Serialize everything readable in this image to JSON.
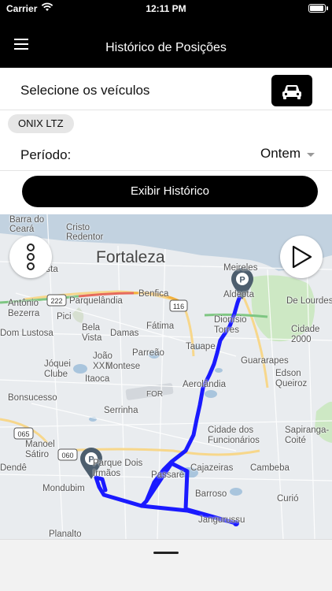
{
  "status_bar": {
    "carrier": "Carrier",
    "time": "12:11 PM"
  },
  "nav": {
    "title": "Histórico de Posições",
    "menu_icon": "hamburger-menu-icon"
  },
  "vehicles": {
    "label": "Selecione os veículos",
    "button_icon": "car-icon",
    "selected_chip": "ONIX LTZ"
  },
  "period": {
    "label": "Período:",
    "value": "Ontem"
  },
  "history_button": {
    "label": "Exibir Histórico"
  },
  "map": {
    "route_color": "#1a1aff",
    "marker_color": "#4d5e6e",
    "labels": [
      "Barra do\nCeará",
      "Cristo\nRedentor",
      "Fortaleza",
      "Meireles",
      "Aldeota",
      "esta",
      "Parquelândia",
      "Benfica",
      "Antônio\nBezerra",
      "Pici",
      "Fátima",
      "Dom Lustosa",
      "Bela\nVista",
      "Damas",
      "Dionísio\nTorres",
      "Cidade\n2000",
      "De Lourdes",
      "Parreão",
      "Tauape",
      "João\nXXIII",
      "Jóquei\nClube",
      "Montese",
      "Guararapes",
      "Edson\nQueiroz",
      "Itaoca",
      "FOR",
      "Aerolândia",
      "Bonsucesso",
      "Serrinha",
      "Cidade dos\nFuncionários",
      "Sapiranga-\nCoité",
      "Manoel\nSátiro",
      "Dendê",
      "Parque Dois\nIrmãos",
      "Passaré",
      "Cajazeiras",
      "Cambeba",
      "Mondubim",
      "Barroso",
      "Curió",
      "Planalto",
      "Jangurussu"
    ],
    "road_shields": [
      "222",
      "116",
      "065",
      "060"
    ],
    "more_button_icon": "more-vertical-icon",
    "play_button_icon": "play-icon"
  },
  "bottom_sheet": {
    "handle_icon": "drag-handle-icon"
  }
}
